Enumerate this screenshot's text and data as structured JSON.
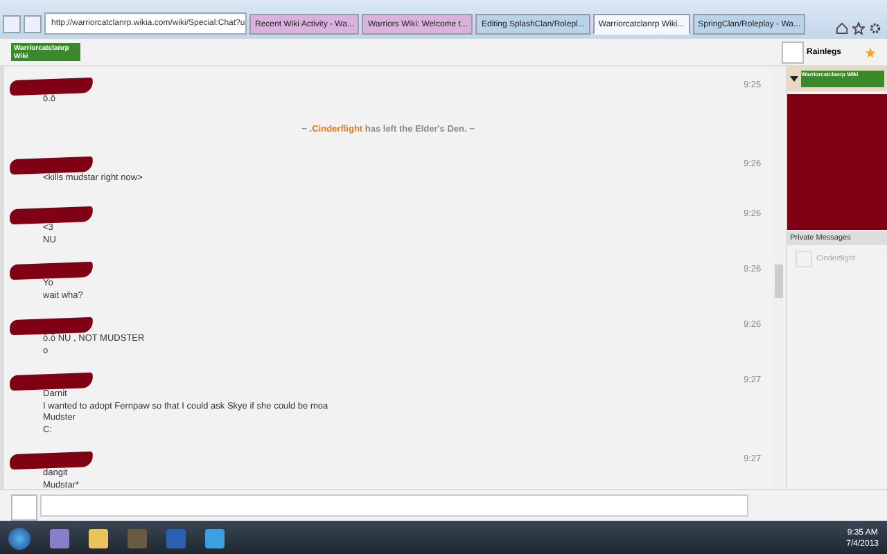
{
  "browser": {
    "address": "http://warriorcatclanrp.wikia.com/wiki/Special:Chat?u",
    "tabs": [
      {
        "label": "Recent Wiki Activity - Wa...",
        "selected": false,
        "color": "#d9b3dd"
      },
      {
        "label": "Warriors Wiki: Welcome t...",
        "selected": false,
        "color": "#d9b3dd"
      },
      {
        "label": "Editing SplashClan/Rolepl...",
        "selected": false,
        "color": "#b9d3e9"
      },
      {
        "label": "Warriorcatclanrp Wiki...",
        "selected": true,
        "color": "#f4f8fc"
      },
      {
        "label": "SpringClan/Roleplay - Wa...",
        "selected": false,
        "color": "#b9d3e9"
      }
    ]
  },
  "wiki": {
    "logo": "Warriorcatclanrp Wiki",
    "user": "Rainlegs"
  },
  "messages": [
    {
      "kind": "message",
      "lines": [
        "ô.ô"
      ],
      "time": "9:25"
    },
    {
      "kind": "notice",
      "text": "~ .**Cinderflight** has left the Elder's Den. ~"
    },
    {
      "kind": "message",
      "lines": [
        "<kills mudstar right now>"
      ],
      "time": "9:26"
    },
    {
      "kind": "message",
      "lines": [
        "<3",
        "NU"
      ],
      "time": "9:26"
    },
    {
      "kind": "message",
      "lines": [
        "Yo",
        "wait wha?"
      ],
      "time": "9:26"
    },
    {
      "kind": "message",
      "lines": [
        "ô.ô NU , NOT MUDSTER",
        "o"
      ],
      "time": "9:26"
    },
    {
      "kind": "message",
      "lines": [
        "Darnit",
        "I wanted to adopt Fernpaw so that I could ask Skye if she could be moa",
        "Mudster",
        "C:"
      ],
      "time": "9:27"
    },
    {
      "kind": "message",
      "lines": [
        "dangit",
        "Mudstar*"
      ],
      "time": "9:27"
    }
  ],
  "sidebar": {
    "room_logo": "Warriorcatclanrp Wiki",
    "private_messages_title": "Private Messages",
    "private_messages": [
      "Cinderflight"
    ]
  },
  "taskbar": {
    "time": "9:35 AM",
    "date": "7/4/2013"
  }
}
